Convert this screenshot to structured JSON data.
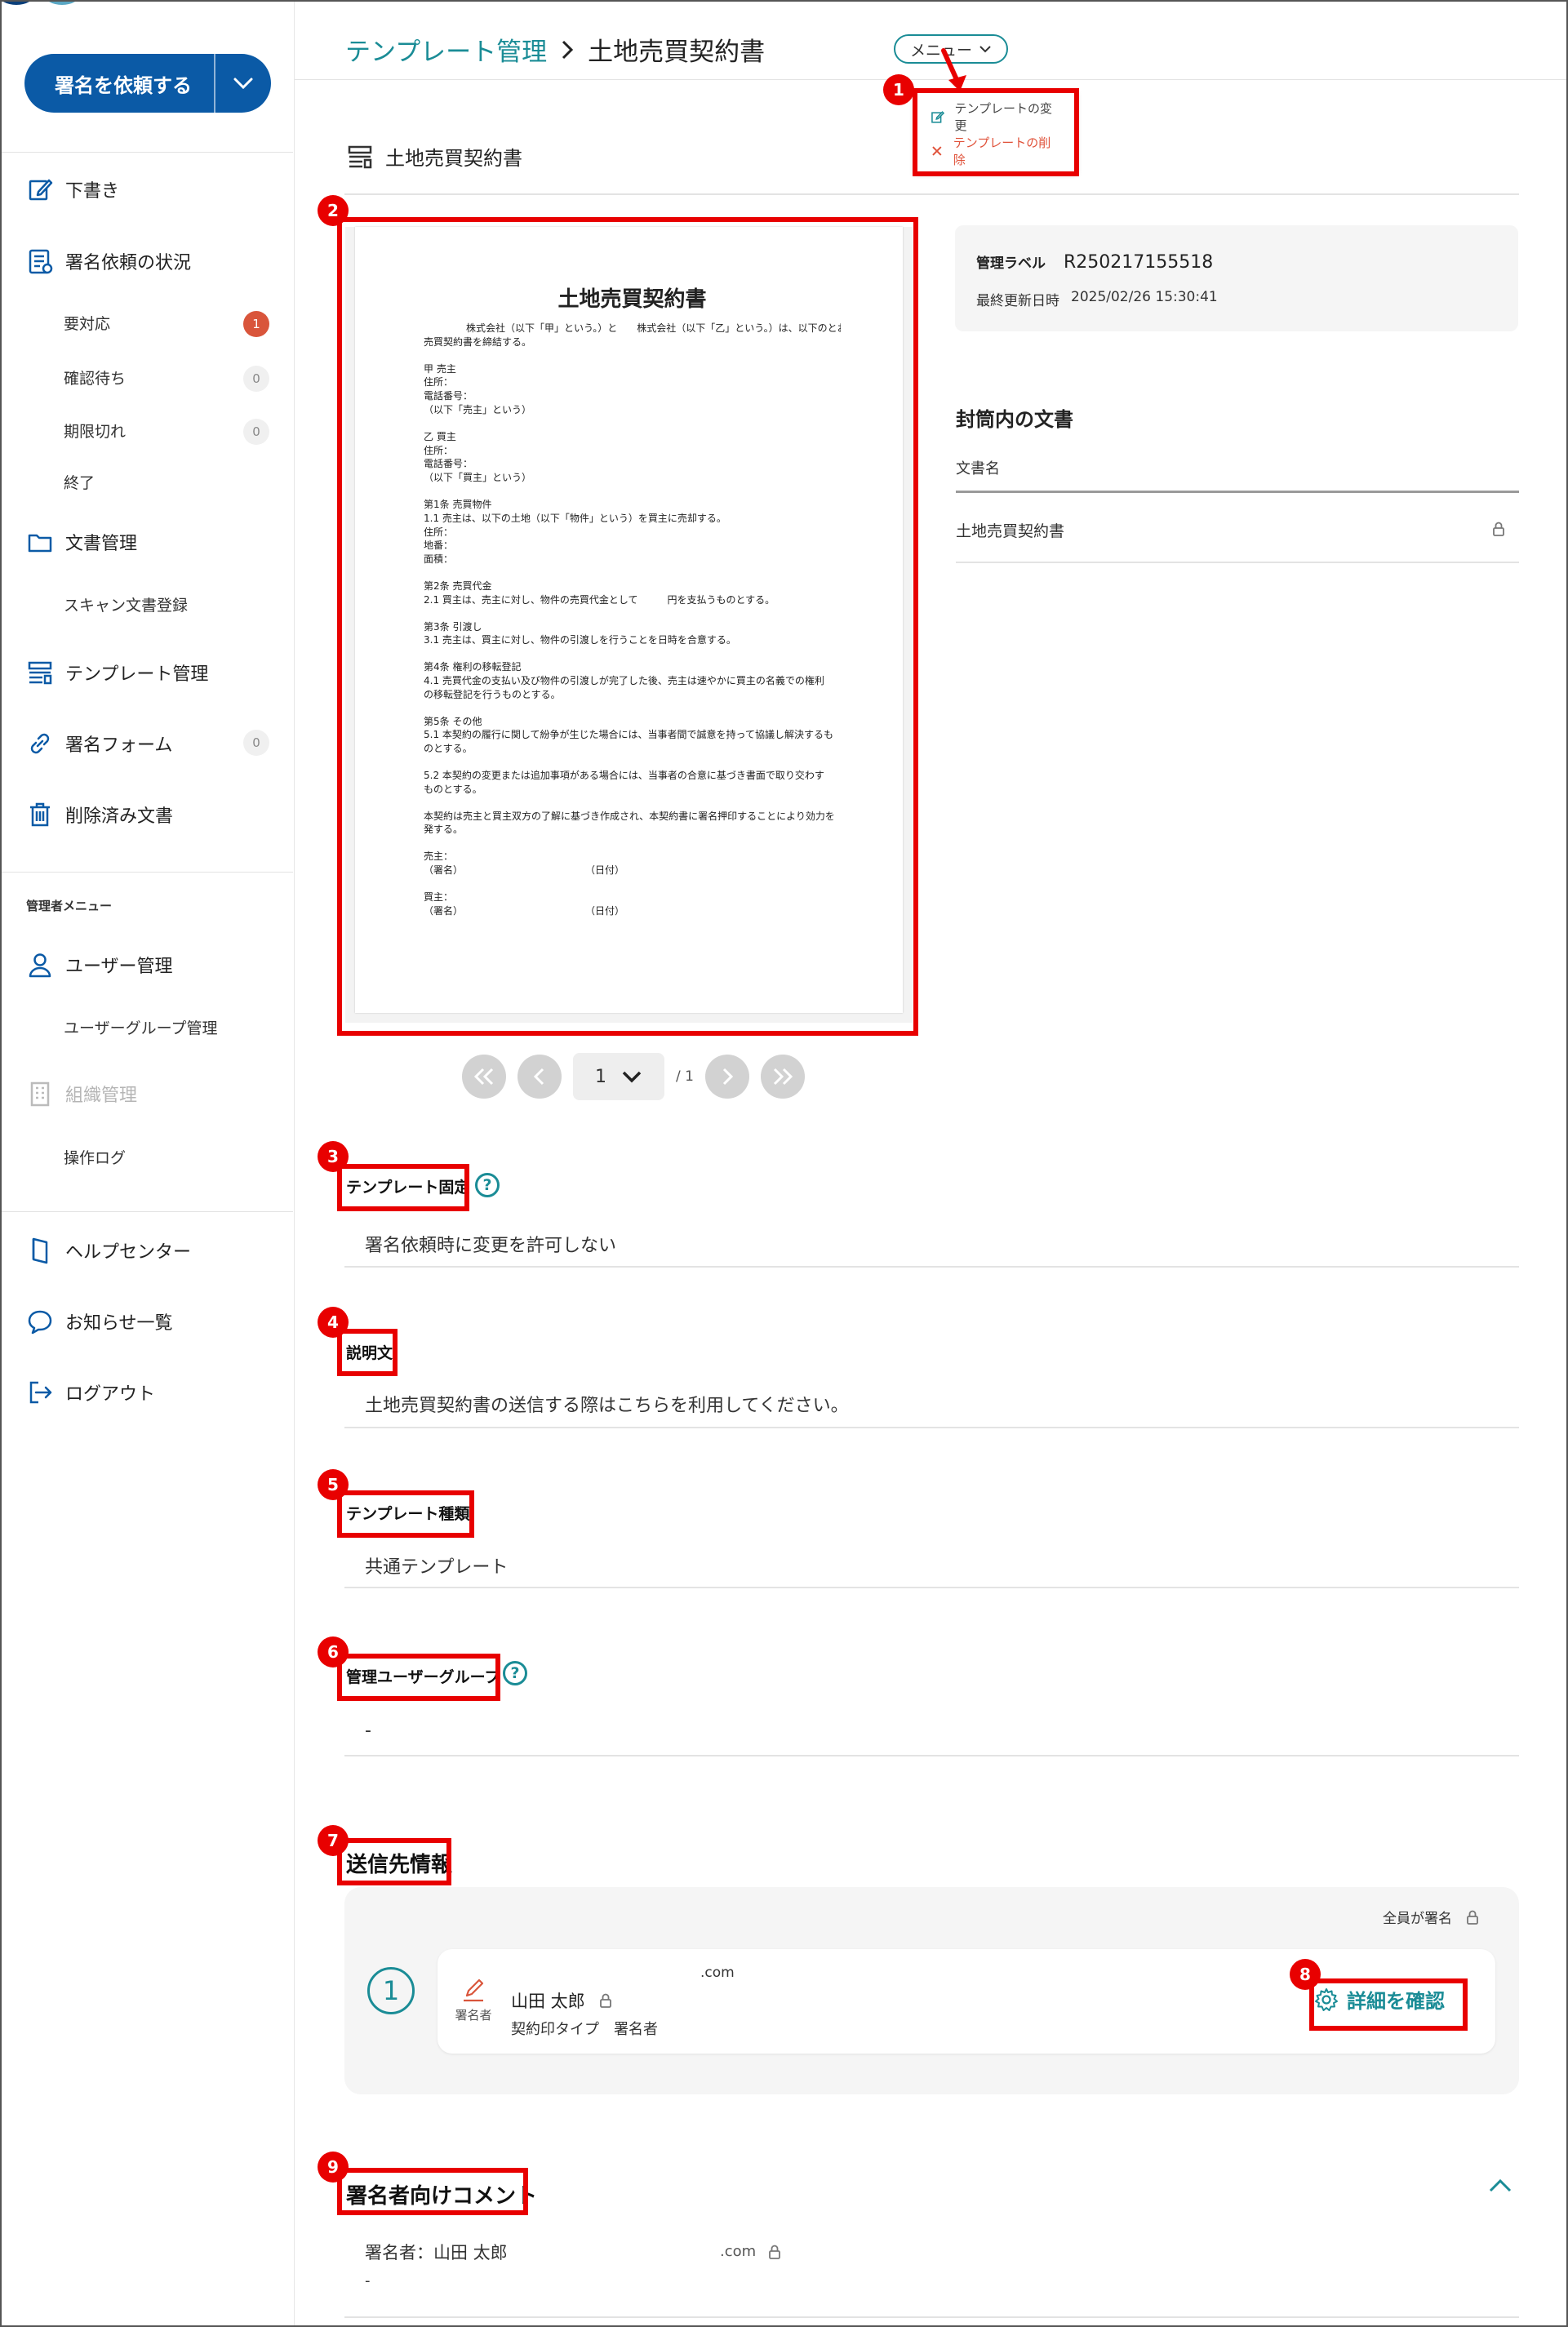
{
  "sidebar": {
    "sign_button": "署名を依頼する",
    "items": {
      "drafts": "下書き",
      "request_status": "署名依頼の状況",
      "action_required": "要対応",
      "action_required_count": "1",
      "awaiting_confirmation": "確認待ち",
      "awaiting_count": "0",
      "expired": "期限切れ",
      "expired_count": "0",
      "completed": "終了",
      "documents": "文書管理",
      "scan_registration": "スキャン文書登録",
      "templates": "テンプレート管理",
      "sign_forms": "署名フォーム",
      "sign_forms_count": "0",
      "deleted_documents": "削除済み文書",
      "admin_menu": "管理者メニュー",
      "user_management": "ユーザー管理",
      "user_group_management": "ユーザーグループ管理",
      "organization": "組織管理",
      "operation_log": "操作ログ",
      "help_center": "ヘルプセンター",
      "notices": "お知らせ一覧",
      "logout": "ログアウト"
    }
  },
  "header": {
    "breadcrumb_link": "テンプレート管理",
    "breadcrumb_current": "土地売買契約書",
    "menu_button": "メニュー"
  },
  "dropdown": {
    "edit": "テンプレートの変更",
    "delete": "テンプレートの削除"
  },
  "badges": [
    "1",
    "2",
    "3",
    "4",
    "5",
    "6",
    "7",
    "8",
    "9"
  ],
  "template": {
    "title": "土地売買契約書"
  },
  "document": {
    "title": "土地売買契約書",
    "intro_1": "株式会社（以下「甲」という。）と　　株式会社（以下「乙」という。）は、以下のとおり",
    "intro_2": "売買契約書を締結する。",
    "seller": [
      "甲  売主",
      "住所：",
      "電話番号：",
      "（以下「売主」という）"
    ],
    "buyer": [
      "乙  買主",
      "住所：",
      "電話番号：",
      "（以下「買主」という）"
    ],
    "art1": [
      "第1条  売買物件",
      "1.1  売主は、以下の土地（以下「物件」という）を買主に売却する。",
      "住所：",
      "地番：",
      "面積："
    ],
    "art2": [
      "第2条  売買代金",
      "2.1  買主は、売主に対し、物件の売買代金として　　　円を支払うものとする。"
    ],
    "art3": [
      "第3条  引渡し",
      "3.1  売主は、買主に対し、物件の引渡しを行うことを日時を合意する。"
    ],
    "art4": [
      "第4条  権利の移転登記",
      "4.1  売買代金の支払い及び物件の引渡しが完了した後、売主は速やかに買主の名義での権利",
      "の移転登記を行うものとする。"
    ],
    "art5": [
      "第5条  その他",
      "5.1  本契約の履行に関して紛争が生じた場合には、当事者間で誠意を持って協議し解決するも",
      "のとする。"
    ],
    "art5_2": [
      "5.2  本契約の変更または追加事項がある場合には、当事者の合意に基づき書面で取り交わす",
      "ものとする。"
    ],
    "closing": [
      "本契約は売主と買主双方の了解に基づき作成され、本契約書に署名押印することにより効力を",
      "発する。"
    ],
    "sign_seller": [
      "売主：",
      "（署名）",
      "（日付）"
    ],
    "sign_buyer": [
      "買主：",
      "（署名）",
      "（日付）"
    ]
  },
  "pager": {
    "current": "1",
    "total": "/ 1"
  },
  "info": {
    "label_key": "管理ラベル",
    "label_value": "R250217155518",
    "updated_key": "最終更新日時",
    "updated_value": "2025/02/26 15:30:41"
  },
  "envelope": {
    "title": "封筒内の文書",
    "column": "文書名",
    "doc_name": "土地売買契約書"
  },
  "fields": {
    "fixed_label": "テンプレート固定",
    "fixed_value": "署名依頼時に変更を許可しない",
    "description_label": "説明文",
    "description_value": "土地売買契約書の送信する際はこちらを利用してください。",
    "type_label": "テンプレート種類",
    "type_value": "共通テンプレート",
    "group_label": "管理ユーザーグループ",
    "group_value": "-"
  },
  "recipients": {
    "title": "送信先情報",
    "all_sign": "全員が署名",
    "order": "1",
    "role": "署名者",
    "name": "山田 太郎",
    "email": ".com",
    "type": "契約印タイプ　署名者",
    "detail_button": "詳細を確認"
  },
  "comments": {
    "title": "署名者向けコメント",
    "signer": "署名者：山田 太郎",
    "email": ".com",
    "body": "-"
  },
  "colors": {
    "primary": "#0b5aa6",
    "accent": "#1a8c96",
    "alert": "#d9553b",
    "annotation": "#e80000"
  }
}
